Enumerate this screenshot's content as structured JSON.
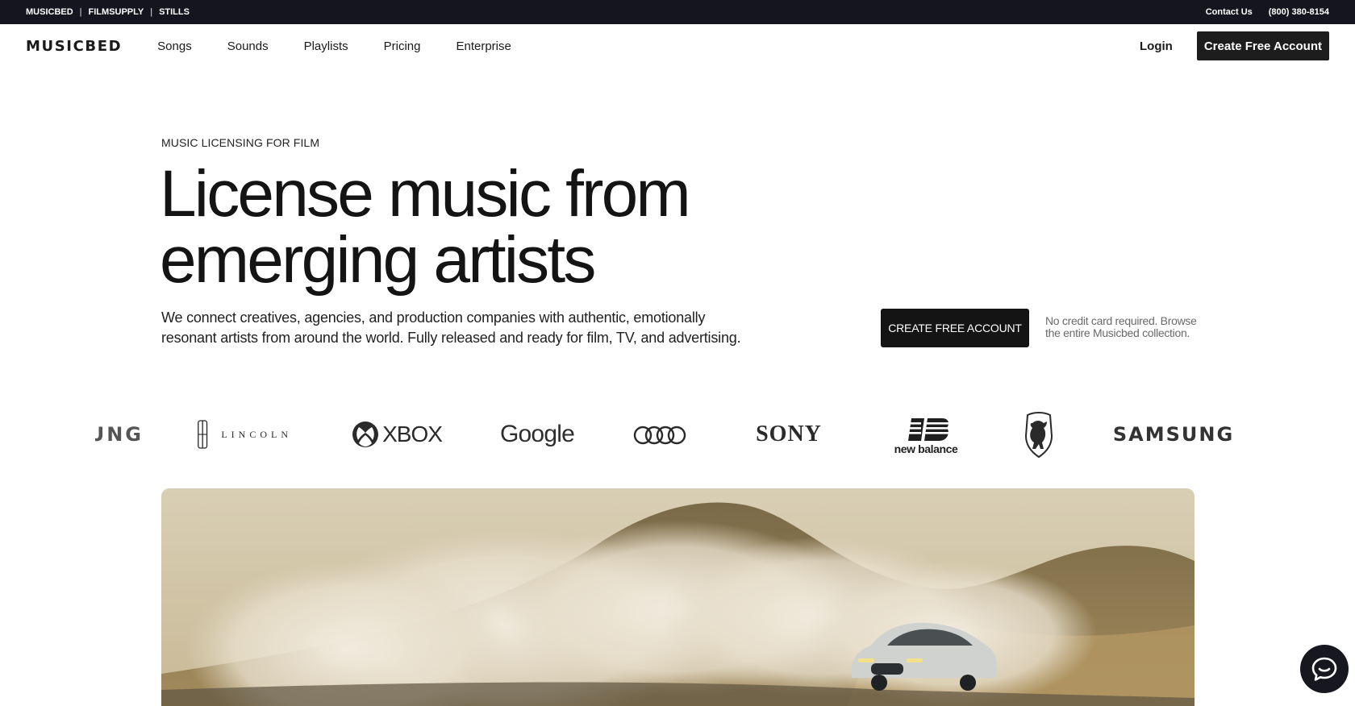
{
  "utility_bar": {
    "sites": [
      "MUSICBED",
      "FILMSUPPLY",
      "STILLS"
    ],
    "separator": "|",
    "contact_label": "Contact Us",
    "phone": "(800) 380-8154"
  },
  "nav": {
    "logo": "MUSICBED",
    "links": [
      "Songs",
      "Sounds",
      "Playlists",
      "Pricing",
      "Enterprise"
    ],
    "login_label": "Login",
    "signup_label": "Create Free Account"
  },
  "hero": {
    "eyebrow": "MUSIC LICENSING FOR FILM",
    "heading_line1": "License music from",
    "heading_line2": "emerging artists",
    "subtext": "We connect creatives, agencies, and production companies with authentic, emotionally resonant artists from around the world. Fully released and ready for film, TV, and advertising.",
    "cta_label": "CREATE FREE ACCOUNT",
    "cta_note": "No credit card required. Browse the entire Musicbed collection."
  },
  "logos": {
    "samsung_partial": "UNG",
    "lincoln": "LINCOLN",
    "xbox": "XBOX",
    "google": "Google",
    "sony": "SONY",
    "new_balance": "new balance",
    "samsung": "SAMSUNG"
  },
  "icons": {
    "chat": "chat-bubble-icon",
    "audi": "audi-rings-icon",
    "lamborghini": "lamborghini-bull-icon"
  },
  "colors": {
    "utility_bar_bg": "#14151f",
    "button_bg": "#141414",
    "text": "#151515",
    "muted_text": "#6a6a6a"
  }
}
